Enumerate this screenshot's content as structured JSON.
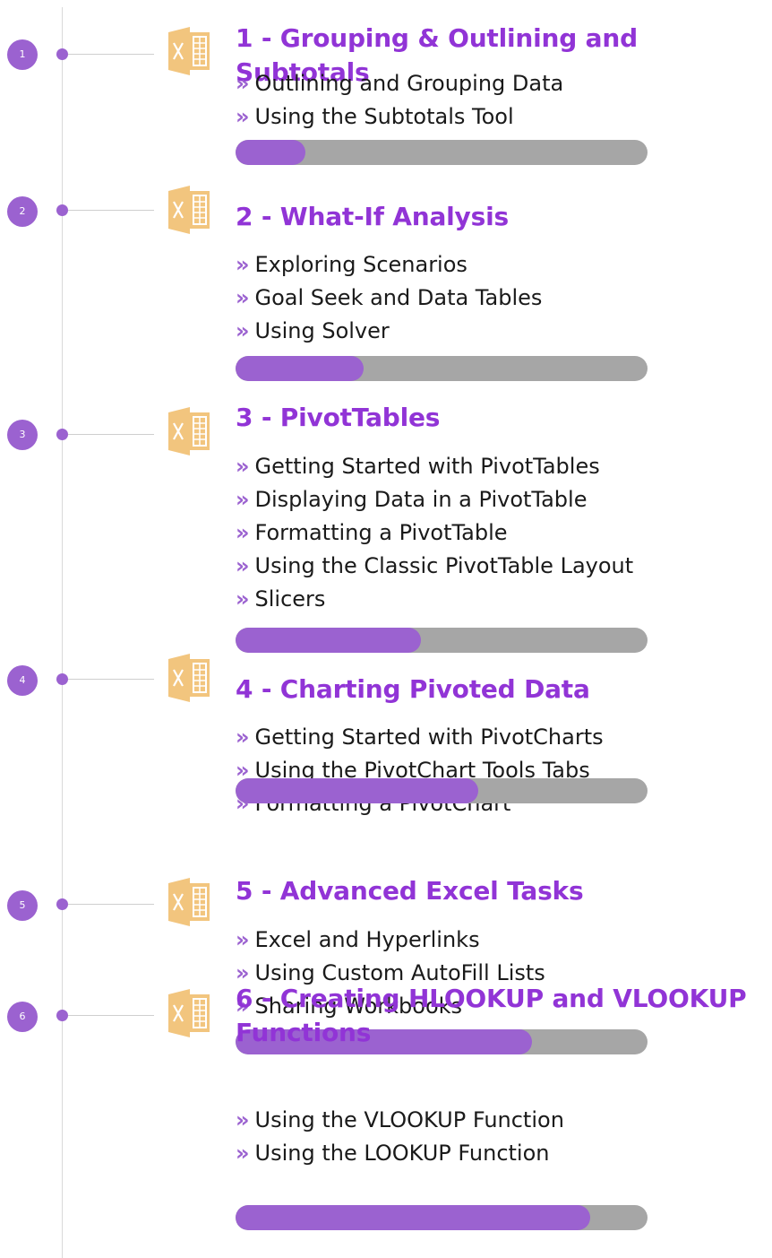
{
  "colors": {
    "accent": "#9b62d0",
    "title": "#9134d6",
    "icon": "#f2c57e",
    "track": "#a6a6a6"
  },
  "bullet_glyph": "»",
  "modules": [
    {
      "number": "1",
      "title": "1 - Grouping & Outlining and Subtotals",
      "icon": "excel-file-icon",
      "lessons": [
        "Outlining and Grouping Data",
        "Using the Subtotals Tool"
      ],
      "progress": 0.17
    },
    {
      "number": "2",
      "title": "2 - What-If Analysis",
      "icon": "excel-file-icon",
      "lessons": [
        "Exploring Scenarios",
        "Goal Seek and Data Tables",
        "Using Solver"
      ],
      "progress": 0.31
    },
    {
      "number": "3",
      "title": "3 - PivotTables",
      "icon": "excel-file-icon",
      "lessons": [
        "Getting Started with PivotTables",
        "Displaying Data in a PivotTable",
        "Formatting a PivotTable",
        "Using the Classic PivotTable Layout",
        "Slicers"
      ],
      "progress": 0.45
    },
    {
      "number": "4",
      "title": "4 - Charting Pivoted Data",
      "icon": "excel-file-icon",
      "lessons": [
        "Getting Started with PivotCharts",
        "Using the PivotChart Tools Tabs",
        "Formatting a PivotChart"
      ],
      "progress": 0.59
    },
    {
      "number": "5",
      "title": "5 - Advanced Excel Tasks",
      "icon": "excel-file-icon",
      "lessons": [
        "Excel and Hyperlinks",
        "Using Custom AutoFill Lists",
        "Sharing Workbooks"
      ],
      "progress": 0.72
    },
    {
      "number": "6",
      "title": "6 - Creating HLOOKUP and VLOOKUP Functions",
      "icon": "excel-file-icon",
      "lessons": [
        "Using the VLOOKUP Function",
        "Using the LOOKUP Function"
      ],
      "progress": 0.86
    }
  ]
}
